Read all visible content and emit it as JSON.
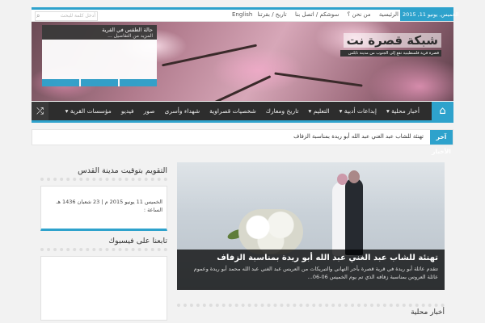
{
  "topbar": {
    "search_placeholder": "أدخل كلمة للبحث",
    "language": "English",
    "menu": [
      "الرئيسية",
      "من نحن ؟",
      "سوشكم / اتصل بنا",
      "تاريخ / بقرتنا"
    ],
    "date": "الخميس, يونيو 11, 2015"
  },
  "header": {
    "site_name": "شبكة قصرة نت",
    "tagline": "قصرة قرية فلسطينية تقع إلى الجنوب من مدينة نابلس",
    "weather_title": "حالة الطقس في القرية",
    "weather_more": "المزيد من التفاصيل ..."
  },
  "nav": {
    "items": [
      "أخبار محلية ▾",
      "إبداعات أدبية ▾",
      "التعليم ▾",
      "تاريخ ومعارك",
      "شخصيات قصراوية",
      "شهداء وأسرى",
      "صور",
      "فيديو",
      "مؤسسات القرية ▾"
    ],
    "home_icon": "home-icon",
    "shuffle_icon": "shuffle-icon"
  },
  "ticker": {
    "label": "آخر الأخبار",
    "text": "تهنئة للشاب عبد الغني عبد الله أبو ريدة بمناسبة الزفاف"
  },
  "sidebar": {
    "calendar_title": "التقويم بتوقيت مدينة القدس",
    "calendar_text": "الخميس 11 يونيو 2015 م | 23 شعبان 1436 هـ الساعة :",
    "facebook_title": "تابعنا على فيسبوك"
  },
  "feature": {
    "headline": "تهنئة للشاب عبد الغني عبد الله أبو ريدة بمناسبة الزفاف",
    "excerpt": "تتقدم عائلة أبو ريدة في قرية قصرة بأحر التهاني والتبريكات من العريس عبد الغني عبد الله محمد أبو ريدة وعموم عائلة العروس بمناسبة زفافه الذي تم يوم الخميس 06-06..."
  },
  "sections": {
    "local_news": "أخبار محلية"
  }
}
